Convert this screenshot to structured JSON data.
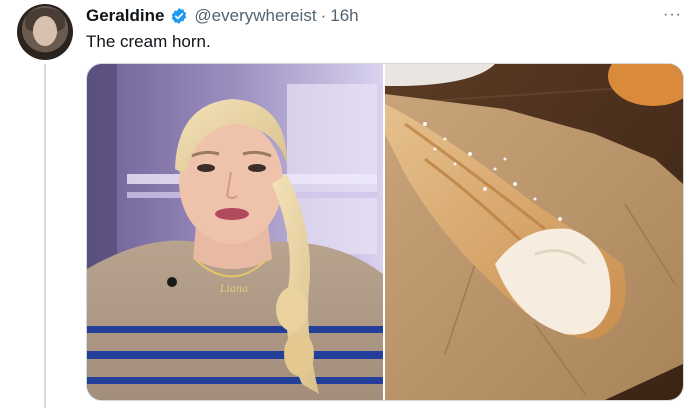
{
  "tweet": {
    "author_name": "Geraldine",
    "handle": "@everywhereist",
    "separator": "·",
    "timestamp": "16h",
    "text": "The cream horn.",
    "more_label": "···"
  },
  "media": {
    "left_photo": {
      "necklace_text": "Liana"
    },
    "right_photo": {}
  },
  "colors": {
    "verified": "#1d9bf0",
    "secondary_text": "#536471",
    "thread_line": "#cfd9de"
  },
  "icons": {
    "verified": "verified-badge-icon",
    "more": "more-options-icon"
  }
}
